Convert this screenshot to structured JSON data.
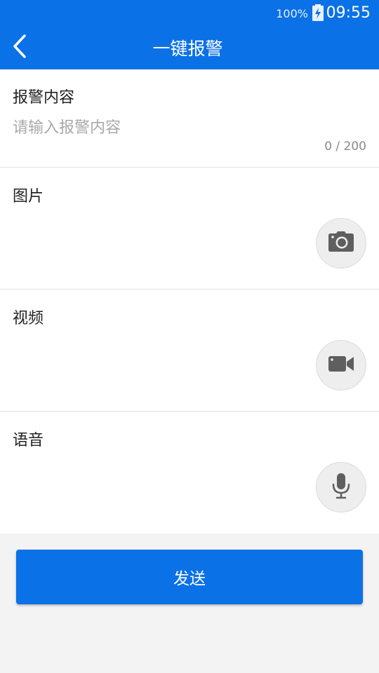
{
  "status_bar": {
    "battery": "100%",
    "time": "09:55"
  },
  "header": {
    "title": "一键报警",
    "back_icon": "chevron-left-icon"
  },
  "sections": {
    "content": {
      "label": "报警内容",
      "placeholder": "请输入报警内容",
      "value": "",
      "counter": "0 / 200"
    },
    "image": {
      "label": "图片",
      "icon": "camera-icon"
    },
    "video": {
      "label": "视频",
      "icon": "video-camera-icon"
    },
    "audio": {
      "label": "语音",
      "icon": "microphone-icon"
    }
  },
  "footer": {
    "send_label": "发送"
  },
  "colors": {
    "primary": "#0b71e6",
    "background": "#f3f3f3",
    "icon": "#5f5f5f"
  }
}
